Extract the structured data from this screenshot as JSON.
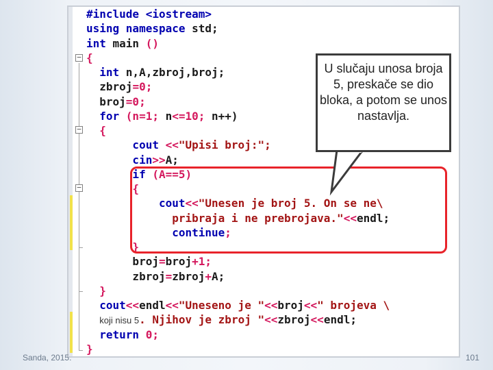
{
  "editor": {
    "lines": [
      [
        {
          "t": "#include <iostream>",
          "c": "kw"
        }
      ],
      [
        {
          "t": "using namespace ",
          "c": "kw"
        },
        {
          "t": "std;",
          "c": "id"
        }
      ],
      [
        {
          "t": "int ",
          "c": "kw"
        },
        {
          "t": "main ",
          "c": "id"
        },
        {
          "t": "()",
          "c": "op"
        }
      ],
      [
        {
          "t": "{",
          "c": "op"
        }
      ],
      [
        {
          "t": "  int ",
          "c": "kw"
        },
        {
          "t": "n,A,zbroj,broj;",
          "c": "id"
        }
      ],
      [
        {
          "t": "  zbroj",
          "c": "id"
        },
        {
          "t": "=0;",
          "c": "op"
        }
      ],
      [
        {
          "t": "  broj",
          "c": "id"
        },
        {
          "t": "=0;",
          "c": "op"
        }
      ],
      [
        {
          "t": "  for ",
          "c": "kw"
        },
        {
          "t": "(n=1; ",
          "c": "op"
        },
        {
          "t": "n",
          "c": "id"
        },
        {
          "t": "<=10; ",
          "c": "op"
        },
        {
          "t": "n++)",
          "c": "id"
        }
      ],
      [
        {
          "t": "  {",
          "c": "op"
        }
      ],
      [
        {
          "t": "       cout ",
          "c": "kw"
        },
        {
          "t": "<<",
          "c": "op"
        },
        {
          "t": "\"Upisi broj:\";",
          "c": "str"
        }
      ],
      [
        {
          "t": "       cin",
          "c": "kw"
        },
        {
          "t": ">>",
          "c": "op"
        },
        {
          "t": "A;",
          "c": "id"
        }
      ],
      [
        {
          "t": "       if ",
          "c": "kw"
        },
        {
          "t": "(A==5)",
          "c": "op"
        }
      ],
      [
        {
          "t": "       {",
          "c": "op"
        }
      ],
      [
        {
          "t": "           cout",
          "c": "kw"
        },
        {
          "t": "<<",
          "c": "op"
        },
        {
          "t": "\"Unesen je broj 5. On se ne\\",
          "c": "str"
        }
      ],
      [
        {
          "t": "             pribraja i ne prebrojava.\"",
          "c": "str"
        },
        {
          "t": "<<",
          "c": "op"
        },
        {
          "t": "endl;",
          "c": "id"
        }
      ],
      [
        {
          "t": "             continue",
          "c": "kw"
        },
        {
          "t": ";",
          "c": "op"
        }
      ],
      [
        {
          "t": "       }",
          "c": "op"
        }
      ],
      [
        {
          "t": "       broj",
          "c": "id"
        },
        {
          "t": "=",
          "c": "op"
        },
        {
          "t": "broj",
          "c": "id"
        },
        {
          "t": "+1;",
          "c": "op"
        }
      ],
      [
        {
          "t": "       zbroj",
          "c": "id"
        },
        {
          "t": "=",
          "c": "op"
        },
        {
          "t": "zbroj",
          "c": "id"
        },
        {
          "t": "+",
          "c": "op"
        },
        {
          "t": "A;",
          "c": "id"
        }
      ],
      [
        {
          "t": "  }",
          "c": "op"
        }
      ],
      [
        {
          "t": "  cout",
          "c": "kw"
        },
        {
          "t": "<<",
          "c": "op"
        },
        {
          "t": "endl",
          "c": "id"
        },
        {
          "t": "<<",
          "c": "op"
        },
        {
          "t": "\"Uneseno je \"",
          "c": "str"
        },
        {
          "t": "<<",
          "c": "op"
        },
        {
          "t": "broj",
          "c": "id"
        },
        {
          "t": "<<",
          "c": "op"
        },
        {
          "t": "\" brojeva \\",
          "c": "str"
        }
      ],
      [
        {
          "t": "  ",
          "c": "id"
        },
        {
          "t": "koji nisu 5",
          "c": "plain-note"
        },
        {
          "t": ". Njihov je zbroj \"",
          "c": "str"
        },
        {
          "t": "<<",
          "c": "op"
        },
        {
          "t": "zbroj",
          "c": "id"
        },
        {
          "t": "<<",
          "c": "op"
        },
        {
          "t": "endl;",
          "c": "id"
        }
      ],
      [
        {
          "t": "  return ",
          "c": "kw"
        },
        {
          "t": "0;",
          "c": "op"
        }
      ],
      [
        {
          "t": "}",
          "c": "op"
        }
      ]
    ]
  },
  "callout": {
    "text": "U slučaju unosa broja 5, preskače se dio bloka, a potom se unos nastavlja."
  },
  "footer": {
    "author": "Sanda, 2015.",
    "page_number": "101"
  },
  "colors": {
    "keyword": "#0000b0",
    "string": "#a31515",
    "operator": "#d4185d",
    "highlight_border": "#e8232a",
    "change_bar": "#f2e24a"
  }
}
